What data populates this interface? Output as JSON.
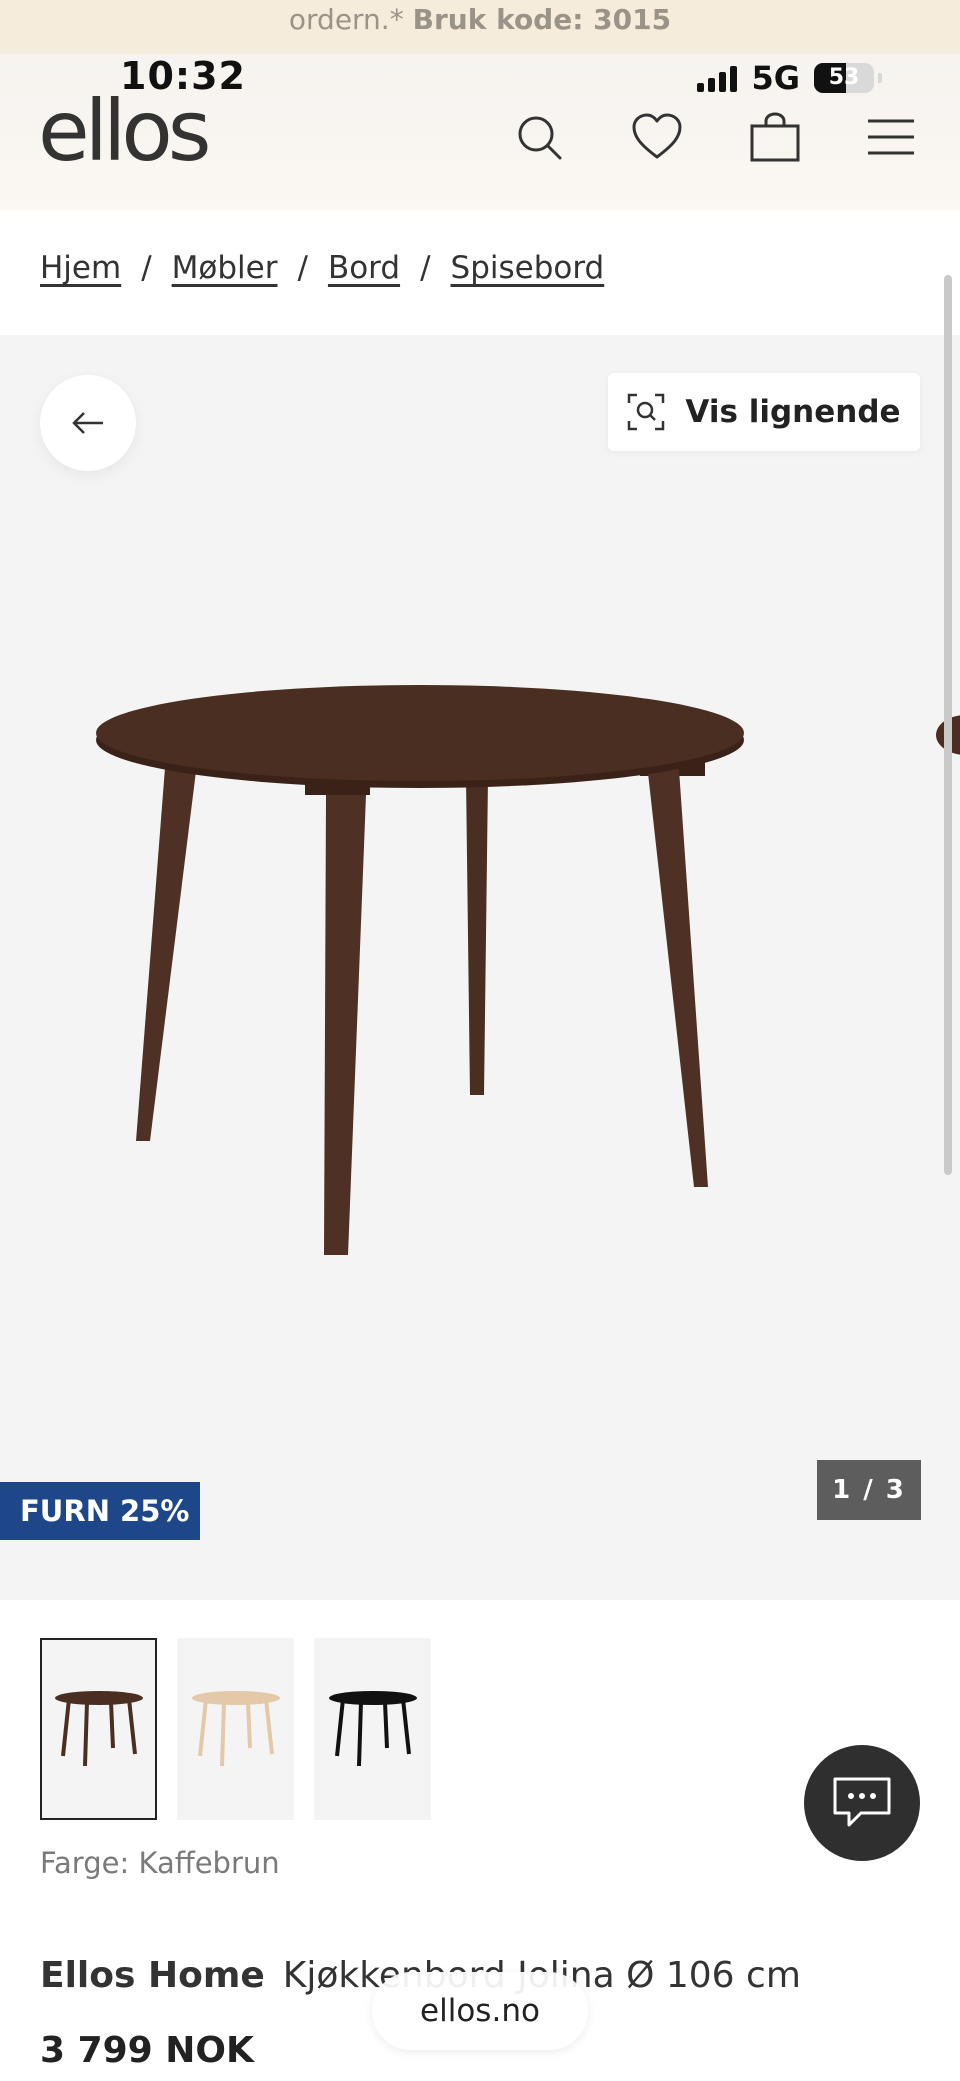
{
  "promo": {
    "text": "ordern.*",
    "code": "Bruk kode: 3015"
  },
  "status_bar": {
    "time": "10:32",
    "network": "5G",
    "battery": "53",
    "battery_pct": 53
  },
  "header": {
    "logo": "ellos",
    "icons": [
      "search-icon",
      "heart-icon",
      "bag-icon",
      "menu-icon"
    ]
  },
  "breadcrumb": {
    "items": [
      "Hjem",
      "Møbler",
      "Bord",
      "Spisebord"
    ],
    "separator": "/"
  },
  "gallery": {
    "similar_button": "Vis lignende",
    "badge": "FURN 25%",
    "counter": "1 / 3",
    "image_index": 1,
    "image_count": 3
  },
  "thumbnails": [
    {
      "color": "#4b2e22",
      "selected": true
    },
    {
      "color": "#e3c9a8",
      "selected": false
    },
    {
      "color": "#111111",
      "selected": false
    }
  ],
  "product": {
    "color_label": "Farge: Kaffebrun",
    "brand": "Ellos Home",
    "name": "Kjøkkenbord Jolina Ø 106 cm",
    "price": "3 799 NOK"
  },
  "browser": {
    "url": "ellos.no"
  },
  "colors": {
    "badge": "#1e4789",
    "promo_bg": "#f6ecdc",
    "table_wood": "#4b2e22"
  }
}
